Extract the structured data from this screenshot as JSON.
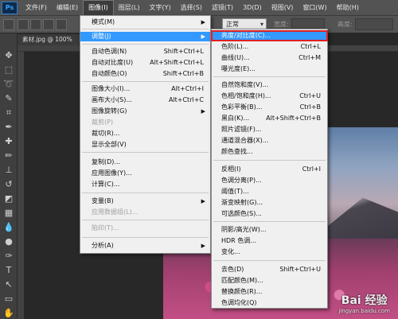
{
  "menubar": {
    "logo": "Ps",
    "items": [
      "文件(F)",
      "编辑(E)",
      "图像(I)",
      "图层(L)",
      "文字(Y)",
      "选择(S)",
      "滤镜(T)",
      "3D(D)",
      "视图(V)",
      "窗口(W)",
      "帮助(H)"
    ],
    "active_index": 2
  },
  "optbar": {
    "mode_label": "",
    "mode_value": "正常",
    "width_label": "宽度:",
    "height_label": "高度:"
  },
  "document": {
    "tab_title": "素材.jpg @ 100%"
  },
  "image_menu": {
    "items": [
      {
        "label": "模式(M)",
        "shortcut": "",
        "submenu": true,
        "disabled": false
      },
      {
        "label": "调整(J)",
        "shortcut": "",
        "submenu": true,
        "disabled": false,
        "highlighted": true
      },
      {
        "label": "自动色调(N)",
        "shortcut": "Shift+Ctrl+L",
        "submenu": false,
        "disabled": false
      },
      {
        "label": "自动对比度(U)",
        "shortcut": "Alt+Shift+Ctrl+L",
        "submenu": false,
        "disabled": false
      },
      {
        "label": "自动颜色(O)",
        "shortcut": "Shift+Ctrl+B",
        "submenu": false,
        "disabled": false
      },
      {
        "label": "图像大小(I)...",
        "shortcut": "Alt+Ctrl+I",
        "submenu": false,
        "disabled": false
      },
      {
        "label": "画布大小(S)...",
        "shortcut": "Alt+Ctrl+C",
        "submenu": false,
        "disabled": false
      },
      {
        "label": "图像旋转(G)",
        "shortcut": "",
        "submenu": true,
        "disabled": false
      },
      {
        "label": "裁剪(P)",
        "shortcut": "",
        "submenu": false,
        "disabled": true
      },
      {
        "label": "裁切(R)...",
        "shortcut": "",
        "submenu": false,
        "disabled": false
      },
      {
        "label": "显示全部(V)",
        "shortcut": "",
        "submenu": false,
        "disabled": false
      },
      {
        "label": "复制(D)...",
        "shortcut": "",
        "submenu": false,
        "disabled": false
      },
      {
        "label": "应用图像(Y)...",
        "shortcut": "",
        "submenu": false,
        "disabled": false
      },
      {
        "label": "计算(C)...",
        "shortcut": "",
        "submenu": false,
        "disabled": false
      },
      {
        "label": "变量(B)",
        "shortcut": "",
        "submenu": true,
        "disabled": false
      },
      {
        "label": "应用数据组(L)...",
        "shortcut": "",
        "submenu": false,
        "disabled": true
      },
      {
        "label": "陷印(T)...",
        "shortcut": "",
        "submenu": false,
        "disabled": true
      },
      {
        "label": "分析(A)",
        "shortcut": "",
        "submenu": true,
        "disabled": false
      }
    ]
  },
  "adjust_menu": {
    "items": [
      {
        "label": "亮度/对比度(C)...",
        "shortcut": "",
        "highlighted": true
      },
      {
        "label": "色阶(L)...",
        "shortcut": "Ctrl+L"
      },
      {
        "label": "曲线(U)...",
        "shortcut": "Ctrl+M"
      },
      {
        "label": "曝光度(E)...",
        "shortcut": ""
      },
      {
        "label": "自然饱和度(V)...",
        "shortcut": ""
      },
      {
        "label": "色相/饱和度(H)...",
        "shortcut": "Ctrl+U"
      },
      {
        "label": "色彩平衡(B)...",
        "shortcut": "Ctrl+B"
      },
      {
        "label": "黑白(K)...",
        "shortcut": "Alt+Shift+Ctrl+B"
      },
      {
        "label": "照片滤镜(F)...",
        "shortcut": ""
      },
      {
        "label": "通道混合器(X)...",
        "shortcut": ""
      },
      {
        "label": "颜色查找...",
        "shortcut": ""
      },
      {
        "label": "反相(I)",
        "shortcut": "Ctrl+I"
      },
      {
        "label": "色调分离(P)...",
        "shortcut": ""
      },
      {
        "label": "阈值(T)...",
        "shortcut": ""
      },
      {
        "label": "渐变映射(G)...",
        "shortcut": ""
      },
      {
        "label": "可选颜色(S)...",
        "shortcut": ""
      },
      {
        "label": "阴影/高光(W)...",
        "shortcut": ""
      },
      {
        "label": "HDR 色调...",
        "shortcut": ""
      },
      {
        "label": "变化...",
        "shortcut": ""
      },
      {
        "label": "去色(D)",
        "shortcut": "Shift+Ctrl+U"
      },
      {
        "label": "匹配颜色(M)...",
        "shortcut": ""
      },
      {
        "label": "替换颜色(R)...",
        "shortcut": ""
      },
      {
        "label": "色调均化(Q)",
        "shortcut": ""
      }
    ]
  },
  "watermark": {
    "main": "Bai 经验",
    "sub": "jingyan.baidu.com"
  },
  "colors": {
    "highlight": "#3399ff",
    "box_outline": "#e02020",
    "ui_dark": "#535353"
  }
}
